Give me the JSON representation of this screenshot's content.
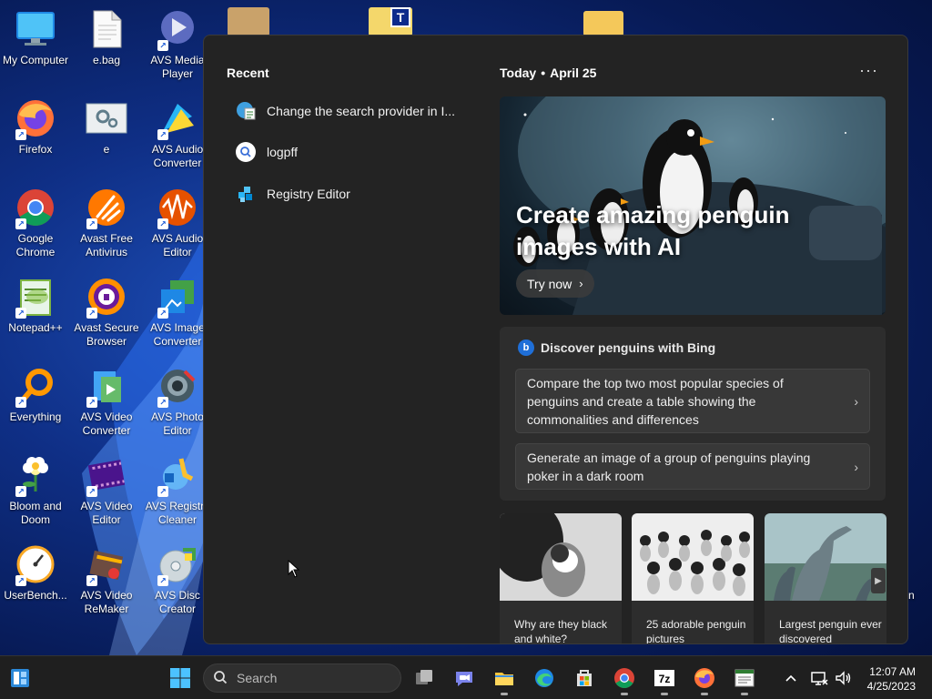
{
  "desktop": {
    "icons": [
      {
        "label": "My Computer",
        "icon": "monitor-icon"
      },
      {
        "label": "e.bag",
        "icon": "document-icon"
      },
      {
        "label": "AVS Media Player",
        "icon": "avs-media-player-icon"
      },
      {
        "label": "Firefox",
        "icon": "firefox-icon"
      },
      {
        "label": "e",
        "icon": "settings-file-icon"
      },
      {
        "label": "AVS Audio Converter",
        "icon": "avs-audio-converter-icon"
      },
      {
        "label": "Google Chrome",
        "icon": "chrome-icon"
      },
      {
        "label": "Avast Free Antivirus",
        "icon": "avast-icon"
      },
      {
        "label": "AVS Audio Editor",
        "icon": "avs-audio-editor-icon"
      },
      {
        "label": "Notepad++",
        "icon": "notepadpp-icon"
      },
      {
        "label": "Avast Secure Browser",
        "icon": "avast-browser-icon"
      },
      {
        "label": "AVS Image Converter",
        "icon": "avs-image-converter-icon"
      },
      {
        "label": "Everything",
        "icon": "everything-icon"
      },
      {
        "label": "AVS Video Converter",
        "icon": "avs-video-converter-icon"
      },
      {
        "label": "AVS Photo Editor",
        "icon": "avs-photo-editor-icon"
      },
      {
        "label": "Bloom and Doom",
        "icon": "bloom-doom-icon"
      },
      {
        "label": "AVS Video Editor",
        "icon": "avs-video-editor-icon"
      },
      {
        "label": "AVS Registry Cleaner",
        "icon": "avs-registry-cleaner-icon"
      },
      {
        "label": "UserBench...",
        "icon": "userbench-icon"
      },
      {
        "label": "AVS Video ReMaker",
        "icon": "avs-video-remaker-icon"
      },
      {
        "label": "AVS Disc Creator",
        "icon": "avs-disc-creator-icon"
      }
    ],
    "partial_label_right": "n"
  },
  "search_flyout": {
    "recent_title": "Recent",
    "recent_items": [
      {
        "label": "Change the search provider in I...",
        "icon": "settings-page-icon"
      },
      {
        "label": "logpff",
        "icon": "search-icon"
      },
      {
        "label": "Registry Editor",
        "icon": "registry-icon"
      }
    ],
    "today_label": "Today",
    "date_label": "April 25",
    "more_label": "···",
    "hero": {
      "title": "Create amazing penguin images with AI",
      "button_label": "Try now"
    },
    "bing_card": {
      "title": "Discover penguins with Bing",
      "prompts": [
        "Compare the top two most popular species of penguins and create a table showing the commonalities and differences",
        "Generate an image of a group of penguins playing poker in a dark room"
      ]
    },
    "thumbnails": [
      {
        "caption": "Why are they black and white?"
      },
      {
        "caption": "25 adorable penguin pictures"
      },
      {
        "caption": "Largest penguin ever discovered"
      }
    ]
  },
  "taskbar": {
    "search_placeholder": "Search",
    "time": "12:07 AM",
    "date": "4/25/2023",
    "apps": [
      "widgets-icon",
      "start-icon",
      "task-view-icon",
      "teams-chat-icon",
      "file-explorer-icon",
      "edge-icon",
      "store-icon",
      "chrome-icon",
      "7zip-icon",
      "firefox-icon",
      "notepad-app-icon"
    ],
    "tray": [
      "chevron-up-icon",
      "network-icon",
      "volume-icon"
    ]
  }
}
